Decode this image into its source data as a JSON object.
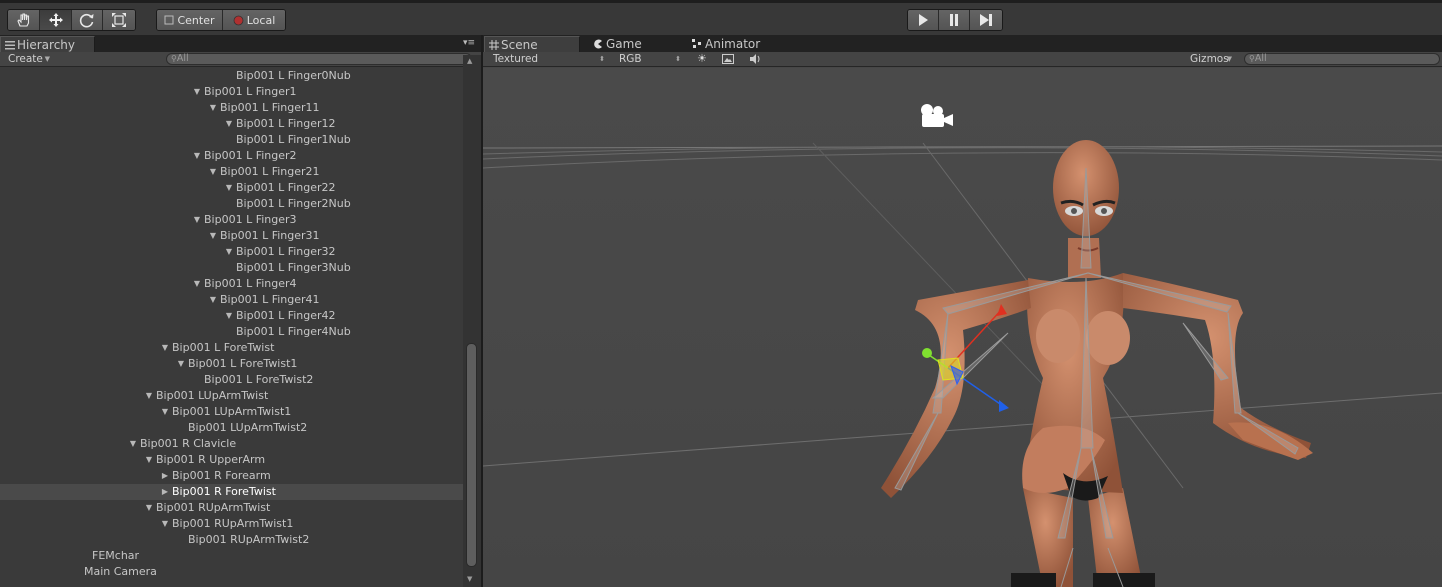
{
  "toolbar": {
    "tools": [
      {
        "name": "hand-tool",
        "icon": "hand-icon",
        "active": false
      },
      {
        "name": "move-tool",
        "icon": "move-arrows-icon",
        "active": true
      },
      {
        "name": "rotate-tool",
        "icon": "rotate-icon",
        "active": false
      },
      {
        "name": "scale-tool",
        "icon": "scale-icon",
        "active": false
      }
    ],
    "pivot_mode": "Center",
    "pivot_rotation": "Local",
    "playback": [
      "play-icon",
      "pause-icon",
      "step-icon"
    ]
  },
  "hierarchy": {
    "tab_label": "Hierarchy",
    "create_label": "Create",
    "search_placeholder": "All",
    "rows": [
      {
        "label": "Bip001 L Finger0Nub",
        "indent": 6,
        "arrow": "none"
      },
      {
        "label": "Bip001 L Finger1",
        "indent": 4,
        "arrow": "down"
      },
      {
        "label": "Bip001 L Finger11",
        "indent": 5,
        "arrow": "down"
      },
      {
        "label": "Bip001 L Finger12",
        "indent": 6,
        "arrow": "down"
      },
      {
        "label": "Bip001 L Finger1Nub",
        "indent": 6,
        "arrow": "none"
      },
      {
        "label": "Bip001 L Finger2",
        "indent": 4,
        "arrow": "down"
      },
      {
        "label": "Bip001 L Finger21",
        "indent": 5,
        "arrow": "down"
      },
      {
        "label": "Bip001 L Finger22",
        "indent": 6,
        "arrow": "down"
      },
      {
        "label": "Bip001 L Finger2Nub",
        "indent": 6,
        "arrow": "none"
      },
      {
        "label": "Bip001 L Finger3",
        "indent": 4,
        "arrow": "down"
      },
      {
        "label": "Bip001 L Finger31",
        "indent": 5,
        "arrow": "down"
      },
      {
        "label": "Bip001 L Finger32",
        "indent": 6,
        "arrow": "down"
      },
      {
        "label": "Bip001 L Finger3Nub",
        "indent": 6,
        "arrow": "none"
      },
      {
        "label": "Bip001 L Finger4",
        "indent": 4,
        "arrow": "down"
      },
      {
        "label": "Bip001 L Finger41",
        "indent": 5,
        "arrow": "down"
      },
      {
        "label": "Bip001 L Finger42",
        "indent": 6,
        "arrow": "down"
      },
      {
        "label": "Bip001 L Finger4Nub",
        "indent": 6,
        "arrow": "none"
      },
      {
        "label": "Bip001 L ForeTwist",
        "indent": 2,
        "arrow": "down"
      },
      {
        "label": "Bip001 L ForeTwist1",
        "indent": 3,
        "arrow": "down"
      },
      {
        "label": "Bip001 L ForeTwist2",
        "indent": 4,
        "arrow": "none"
      },
      {
        "label": "Bip001 LUpArmTwist",
        "indent": 1,
        "arrow": "down"
      },
      {
        "label": "Bip001 LUpArmTwist1",
        "indent": 2,
        "arrow": "down"
      },
      {
        "label": "Bip001 LUpArmTwist2",
        "indent": 3,
        "arrow": "none"
      },
      {
        "label": "Bip001 R Clavicle",
        "indent": 0,
        "arrow": "down"
      },
      {
        "label": "Bip001 R UpperArm",
        "indent": 1,
        "arrow": "down"
      },
      {
        "label": "Bip001 R Forearm",
        "indent": 2,
        "arrow": "right"
      },
      {
        "label": "Bip001 R ForeTwist",
        "indent": 2,
        "arrow": "right",
        "selected": true
      },
      {
        "label": "Bip001 RUpArmTwist",
        "indent": 1,
        "arrow": "down"
      },
      {
        "label": "Bip001 RUpArmTwist1",
        "indent": 2,
        "arrow": "down"
      },
      {
        "label": "Bip001 RUpArmTwist2",
        "indent": 3,
        "arrow": "none"
      },
      {
        "label": "FEMchar",
        "indent": -3,
        "arrow": "none"
      },
      {
        "label": "Main Camera",
        "indent": -3.5,
        "arrow": "none"
      }
    ]
  },
  "tabs": [
    {
      "label": "Scene",
      "icon": "grid-icon",
      "active": true
    },
    {
      "label": "Game",
      "icon": "pacman-icon",
      "active": false
    },
    {
      "label": "Animator",
      "icon": "animator-icon",
      "active": false
    }
  ],
  "scene_toolbar": {
    "render_mode": "Textured",
    "color_mode": "RGB",
    "icons": [
      "sun-icon",
      "image-icon",
      "speaker-icon"
    ],
    "gizmos_label": "Gizmos",
    "search_placeholder": "All"
  },
  "colors": {
    "skin": "#b57454",
    "selection_row": "#4a4a4a",
    "gizmo_x": "#e03020",
    "gizmo_y": "#80e030",
    "gizmo_z": "#2050e0"
  }
}
